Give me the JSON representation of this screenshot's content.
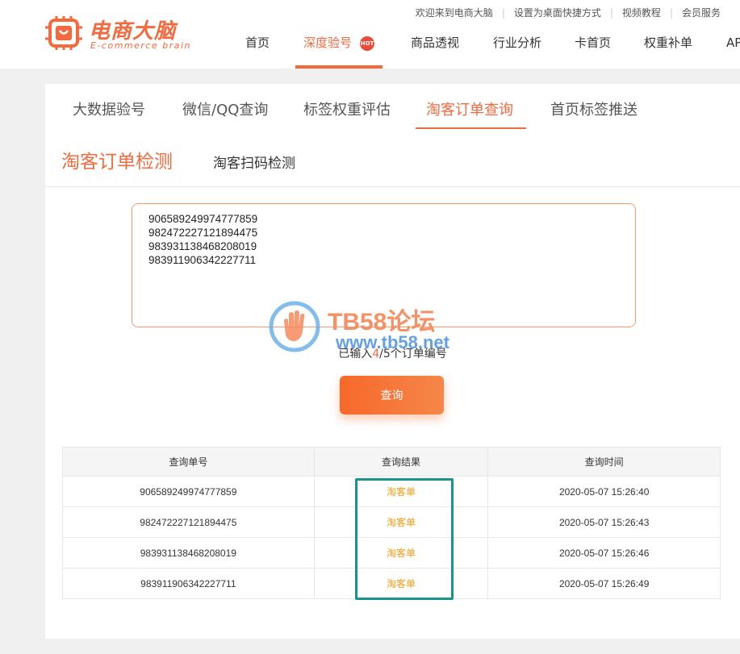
{
  "brand": {
    "name": "电商大脑",
    "tagline": "E-commerce brain",
    "color": "#f26a3d"
  },
  "top_links": [
    "欢迎来到电商大脑",
    "设置为桌面快捷方式",
    "视频教程",
    "会员服务"
  ],
  "nav": {
    "items": [
      "首页",
      "深度验号",
      "商品透视",
      "行业分析",
      "卡首页",
      "权重补单",
      "AP"
    ],
    "active": "深度验号",
    "hot_badge": "HOT"
  },
  "tabs": {
    "items": [
      "大数据验号",
      "微信/QQ查询",
      "标签权重评估",
      "淘客订单查询",
      "首页标签推送"
    ],
    "active": "淘客订单查询"
  },
  "subtabs": {
    "active": "淘客订单检测",
    "other": "淘客扫码检测"
  },
  "order_input": {
    "value": "906589249974777859\n982472227121894475\n983931138468208019\n983911906342227711"
  },
  "status": {
    "prefix": "已输入",
    "entered": "4",
    "suffix": "/5个订单编号"
  },
  "query_button": "查询",
  "table": {
    "headers": [
      "查询单号",
      "查询结果",
      "查询时间"
    ],
    "rows": [
      {
        "order": "906589249974777859",
        "result": "淘客单",
        "time": "2020-05-07 15:26:40"
      },
      {
        "order": "982472227121894475",
        "result": "淘客单",
        "time": "2020-05-07 15:26:43"
      },
      {
        "order": "983931138468208019",
        "result": "淘客单",
        "time": "2020-05-07 15:26:46"
      },
      {
        "order": "983911906342227711",
        "result": "淘客单",
        "time": "2020-05-07 15:26:49"
      }
    ]
  },
  "watermark": {
    "title": "TB58论坛",
    "url": "www.tb58.net"
  },
  "colors": {
    "accent": "#f26a3d",
    "result": "#f39c12",
    "highlight": "#17958c"
  }
}
